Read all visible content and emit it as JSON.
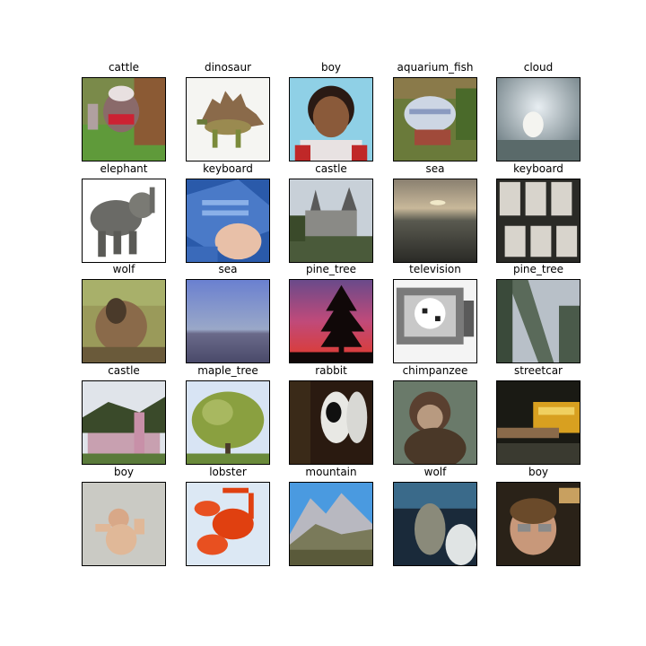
{
  "images": [
    {
      "label": "cattle",
      "icon": "cattle-photo"
    },
    {
      "label": "dinosaur",
      "icon": "dinosaur-photo"
    },
    {
      "label": "boy",
      "icon": "boy-photo"
    },
    {
      "label": "aquarium_fish",
      "icon": "aquarium-fish-photo"
    },
    {
      "label": "cloud",
      "icon": "cloud-photo"
    },
    {
      "label": "elephant",
      "icon": "elephant-photo"
    },
    {
      "label": "keyboard",
      "icon": "keyboard-photo"
    },
    {
      "label": "castle",
      "icon": "castle-photo"
    },
    {
      "label": "sea",
      "icon": "sea-photo"
    },
    {
      "label": "keyboard",
      "icon": "keyboard-photo"
    },
    {
      "label": "wolf",
      "icon": "wolf-photo"
    },
    {
      "label": "sea",
      "icon": "sea-photo"
    },
    {
      "label": "pine_tree",
      "icon": "pine-tree-photo"
    },
    {
      "label": "television",
      "icon": "television-photo"
    },
    {
      "label": "pine_tree",
      "icon": "pine-tree-photo"
    },
    {
      "label": "castle",
      "icon": "castle-photo"
    },
    {
      "label": "maple_tree",
      "icon": "maple-tree-photo"
    },
    {
      "label": "rabbit",
      "icon": "rabbit-photo"
    },
    {
      "label": "chimpanzee",
      "icon": "chimpanzee-photo"
    },
    {
      "label": "streetcar",
      "icon": "streetcar-photo"
    },
    {
      "label": "boy",
      "icon": "boy-photo"
    },
    {
      "label": "lobster",
      "icon": "lobster-photo"
    },
    {
      "label": "mountain",
      "icon": "mountain-photo"
    },
    {
      "label": "wolf",
      "icon": "wolf-photo"
    },
    {
      "label": "boy",
      "icon": "boy-photo"
    }
  ]
}
